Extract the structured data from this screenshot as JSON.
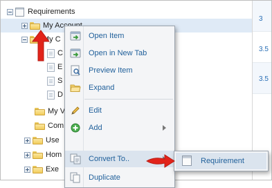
{
  "tree": {
    "root": {
      "label": "Requirements",
      "expander": "minus",
      "icon": "requirement-icon"
    },
    "items": [
      {
        "label": "My Account",
        "expander": "plus",
        "icon": "folder-icon",
        "selected": true
      },
      {
        "label": "My C",
        "expander": "minus",
        "icon": "folder-icon"
      },
      {
        "label": "C",
        "icon": "document-icon"
      },
      {
        "label": "E",
        "icon": "document-icon"
      },
      {
        "label": "S",
        "icon": "document-icon"
      },
      {
        "label": "D",
        "icon": "document-icon"
      },
      {
        "label": "My V",
        "icon": "folder-icon"
      },
      {
        "label": "Com",
        "icon": "folder-icon"
      },
      {
        "label": "Use",
        "expander": "plus",
        "icon": "folder-icon"
      },
      {
        "label": "Hom",
        "expander": "plus",
        "icon": "folder-icon"
      },
      {
        "label": "Exe",
        "expander": "plus",
        "icon": "folder-icon"
      }
    ]
  },
  "grid": {
    "values": [
      "3",
      "3.5",
      "3.5"
    ]
  },
  "context_menu": {
    "items": [
      {
        "label": "Open Item",
        "icon": "open-item-icon"
      },
      {
        "label": "Open in New Tab",
        "icon": "open-new-tab-icon"
      },
      {
        "label": "Preview Item",
        "icon": "preview-icon"
      },
      {
        "label": "Expand",
        "icon": "folder-open-icon"
      },
      {
        "label": "Edit",
        "icon": "pencil-icon"
      },
      {
        "label": "Add",
        "icon": "add-icon",
        "submenu": true
      },
      {
        "label": "Convert To..",
        "icon": "convert-icon",
        "submenu": true,
        "highlighted": true
      },
      {
        "label": "Duplicate",
        "icon": "duplicate-icon"
      }
    ]
  },
  "submenu": {
    "items": [
      {
        "label": "Requirement",
        "icon": "requirement-icon",
        "highlighted": true
      }
    ]
  },
  "annotations": {
    "arrow_color": "#e2231a"
  },
  "colors": {
    "menu_text": "#1f5f9a",
    "grid_text": "#2a6fb5",
    "highlight": "#dbe4ee"
  }
}
